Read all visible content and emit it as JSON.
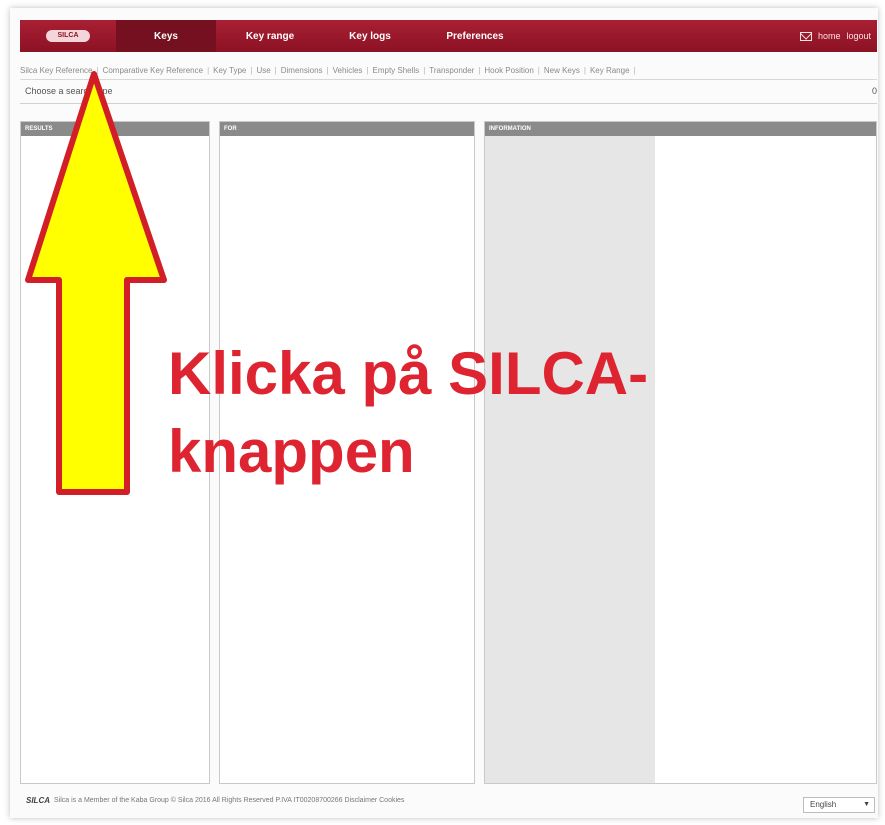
{
  "topnav": {
    "logo": "SILCA",
    "tabs": [
      "Keys",
      "Key range",
      "Key logs",
      "Preferences"
    ],
    "home": "home",
    "logout": "logout"
  },
  "subnav": {
    "items": [
      "Silca Key Reference",
      "Comparative Key Reference",
      "Key Type",
      "Use",
      "Dimensions",
      "Vehicles",
      "Empty Shells",
      "Transponder",
      "Hook Position",
      "New Keys",
      "Key Range"
    ]
  },
  "content": {
    "choose_text": "Choose a search type",
    "right_mark": "0"
  },
  "panels": {
    "results": "RESULTS",
    "for": "FOR",
    "information": "INFORMATION"
  },
  "annotation": {
    "line1": "Klicka på SILCA-",
    "line2": "knappen"
  },
  "footer": {
    "brand": "SILCA",
    "text": "Silca is a Member of the Kaba Group  © Silca 2016  All Rights Reserved  P.IVA IT00208700266  Disclaimer  Cookies"
  },
  "language": {
    "selected": "English"
  },
  "colors": {
    "nav": "#8c1224",
    "annotation_text": "#de2430",
    "arrow_fill": "#ffff00",
    "arrow_stroke": "#d21e26"
  }
}
